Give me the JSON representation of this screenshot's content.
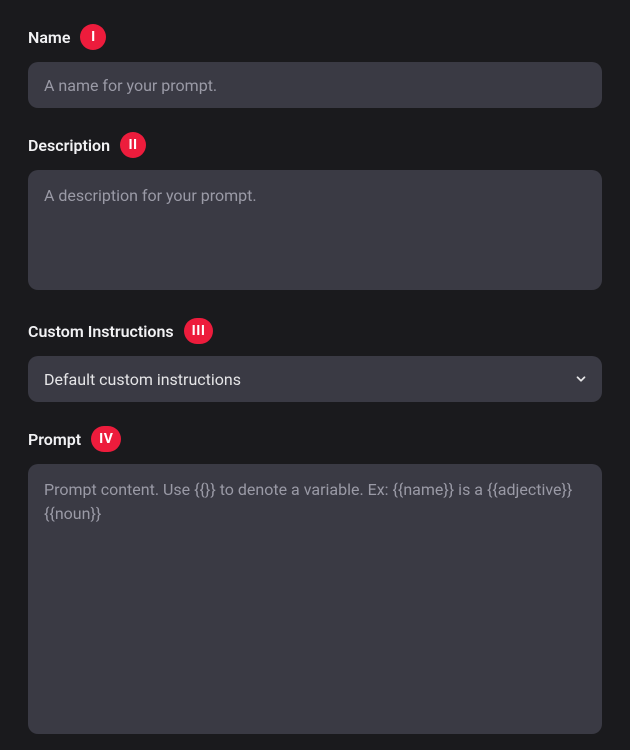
{
  "fields": {
    "name": {
      "label": "Name",
      "badge": "I",
      "placeholder": "A name for your prompt.",
      "value": ""
    },
    "description": {
      "label": "Description",
      "badge": "II",
      "placeholder": "A description for your prompt.",
      "value": ""
    },
    "custom_instructions": {
      "label": "Custom Instructions",
      "badge": "III",
      "selected": "Default custom instructions"
    },
    "prompt": {
      "label": "Prompt",
      "badge": "IV",
      "placeholder": "Prompt content. Use {{}} to denote a variable. Ex: {{name}} is a {{adjective}} {{noun}}",
      "value": ""
    }
  }
}
